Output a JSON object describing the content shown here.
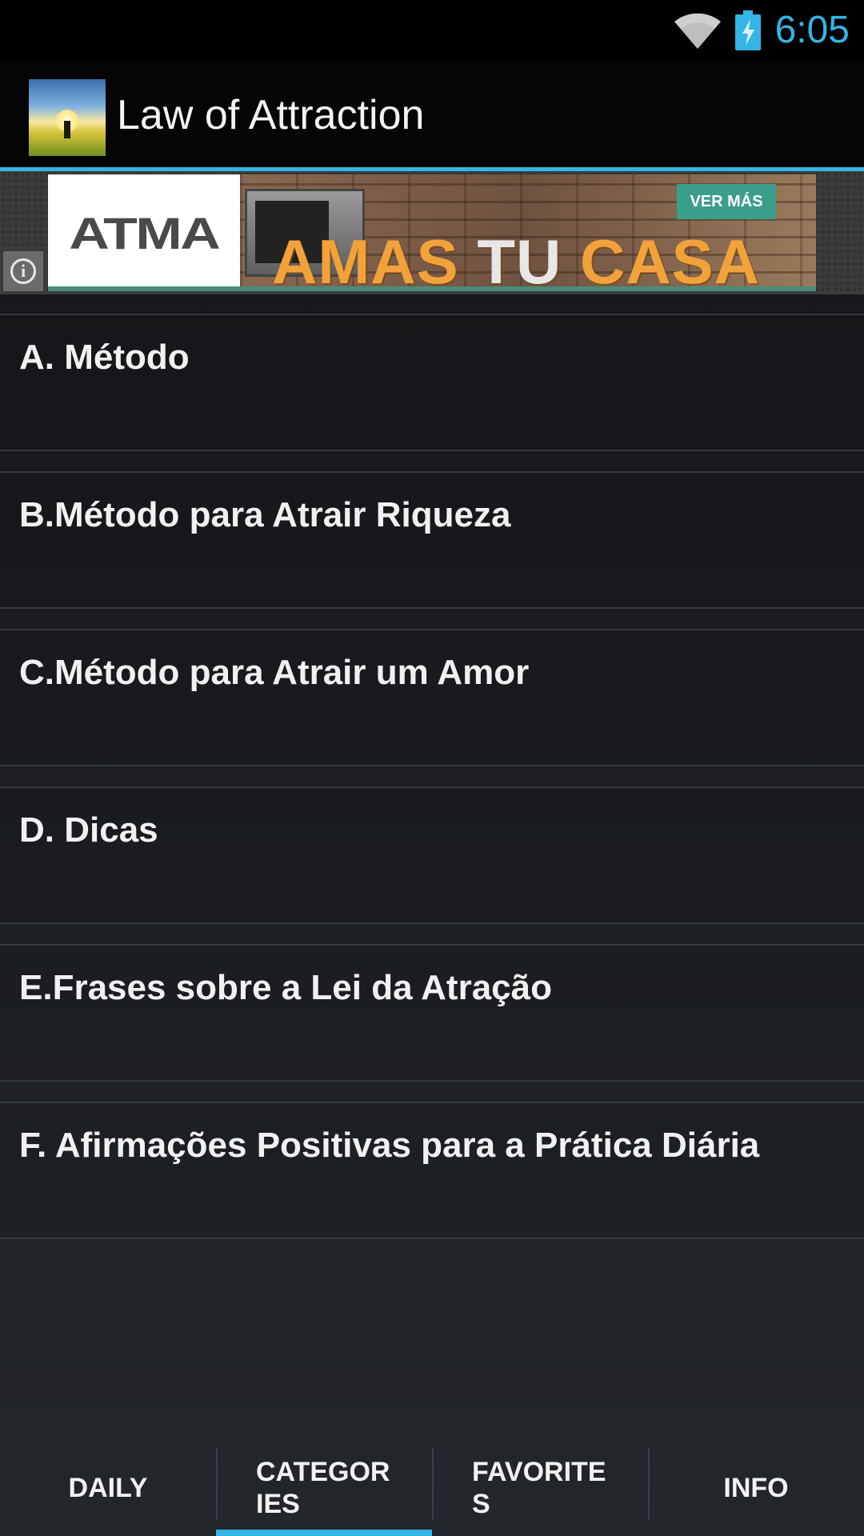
{
  "status_bar": {
    "time": "6:05",
    "icons": [
      "wifi-icon",
      "battery-charging-icon"
    ],
    "accent_color": "#33b5e5"
  },
  "action_bar": {
    "app_icon": "app-logo-sunrise",
    "title": "Law of Attraction"
  },
  "ad": {
    "logo": "ATMA",
    "headline_part1": "AMAS",
    "headline_part2": "TU",
    "headline_part3": "CASA",
    "cta": "VER MÁS",
    "info_icon": "info-icon"
  },
  "categories": [
    {
      "label": "A. Método"
    },
    {
      "label": "B.Método para Atrair Riqueza"
    },
    {
      "label": "C.Método para Atrair um Amor"
    },
    {
      "label": "D. Dicas"
    },
    {
      "label": "E.Frases sobre a Lei da Atração"
    },
    {
      "label": "F. Afirmações Positivas para a Prática Diária"
    }
  ],
  "tabs": [
    {
      "label": "DAILY",
      "selected": false
    },
    {
      "label": "CATEGORIES",
      "selected": true
    },
    {
      "label": "FAVORITES",
      "selected": false
    },
    {
      "label": "INFO",
      "selected": false
    }
  ]
}
